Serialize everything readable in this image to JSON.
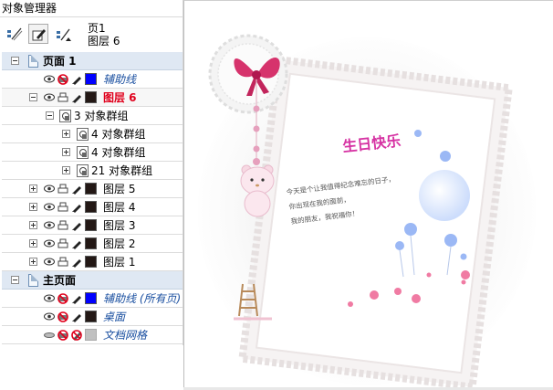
{
  "panel": {
    "title": "对象管理器",
    "current_page_label": "页1",
    "current_layer_label": "图层 6",
    "toolbar": [
      {
        "name": "show-object-properties-button",
        "icon": "object-properties-icon"
      },
      {
        "name": "edit-across-layers-button",
        "icon": "edit-across-layers-icon"
      },
      {
        "name": "layer-manager-view-button",
        "icon": "layer-manager-view-icon"
      }
    ]
  },
  "tree": {
    "page1": {
      "label": "页面 1",
      "guides_label": "辅助线",
      "guides_color": "#0000ff",
      "layer6_label": "图层 6",
      "layer6_color": "#231815",
      "group3_label": "3 对象群组",
      "subgroups": [
        "4 对象群组",
        "4 对象群组",
        "21 对象群组"
      ],
      "other_layers": [
        {
          "label": "图层 5",
          "color": "#231815"
        },
        {
          "label": "图层 4",
          "color": "#231815"
        },
        {
          "label": "图层 3",
          "color": "#231815"
        },
        {
          "label": "图层 2",
          "color": "#231815"
        },
        {
          "label": "图层 1",
          "color": "#231815"
        }
      ]
    },
    "master": {
      "label": "主页面",
      "guides_all_label": "辅助线 (所有页)",
      "guides_all_color": "#0000ff",
      "desktop_label": "桌面",
      "desktop_color": "#231815",
      "grid_label": "文档网格",
      "grid_color": "#c0c0c0"
    }
  },
  "card": {
    "title_text": "生日快乐",
    "message_lines": [
      "今天是个让我值得纪念难忘的日子，",
      "你出现在我的面前，",
      "我的朋友，我祝福你！"
    ],
    "colors": {
      "bow": "#d6336c",
      "title": "#d633a3",
      "frame": "#e8e3e3",
      "balloon": "#9bb8f5",
      "flower": "#f07ba3",
      "bear": "#f7d9e3",
      "ladder": "#b88a5a"
    }
  }
}
